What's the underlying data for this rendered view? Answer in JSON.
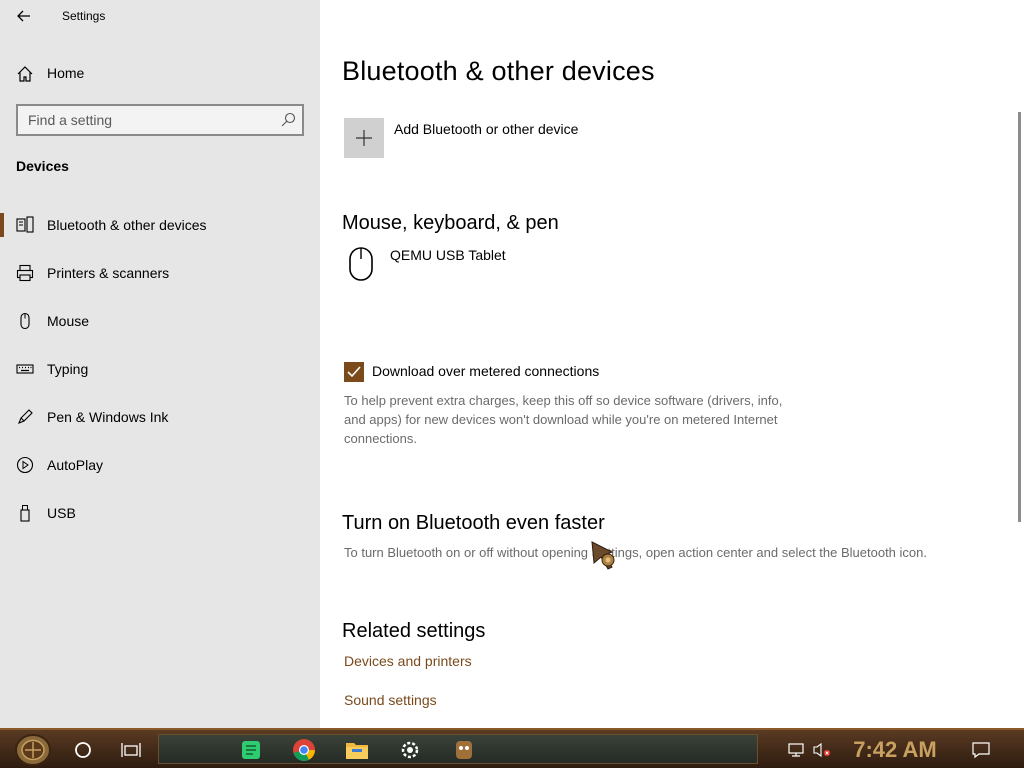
{
  "window": {
    "title": "Settings",
    "back_icon": "arrow-left-icon",
    "minimize_icon": "minimize-icon",
    "restore_icon": "restore-icon",
    "close_icon": "close-icon"
  },
  "sidebar": {
    "home_label": "Home",
    "search_placeholder": "Find a setting",
    "section_title": "Devices",
    "items": [
      {
        "label": "Bluetooth & other devices",
        "icon": "bluetooth-devices-icon",
        "selected": true
      },
      {
        "label": "Printers & scanners",
        "icon": "printer-icon",
        "selected": false
      },
      {
        "label": "Mouse",
        "icon": "mouse-icon",
        "selected": false
      },
      {
        "label": "Typing",
        "icon": "keyboard-icon",
        "selected": false
      },
      {
        "label": "Pen & Windows Ink",
        "icon": "pen-icon",
        "selected": false
      },
      {
        "label": "AutoPlay",
        "icon": "autoplay-icon",
        "selected": false
      },
      {
        "label": "USB",
        "icon": "usb-icon",
        "selected": false
      }
    ]
  },
  "main": {
    "title": "Bluetooth & other devices",
    "add_device_label": "Add Bluetooth or other device",
    "mouse_section_title": "Mouse, keyboard, & pen",
    "device_name": "QEMU USB Tablet",
    "metered_checkbox_label": "Download over metered connections",
    "metered_checked": true,
    "metered_help": "To help prevent extra charges, keep this off so device software (drivers, info, and apps) for new devices won't download while you're on metered Internet connections.",
    "faster_title": "Turn on Bluetooth even faster",
    "faster_text": "To turn Bluetooth on or off without opening Settings, open action center and select the Bluetooth icon.",
    "related_title": "Related settings",
    "related_links": [
      "Devices and printers",
      "Sound settings"
    ]
  },
  "taskbar": {
    "clock": "7:42 AM",
    "icons": [
      "start-icon",
      "cortana-icon",
      "task-view-icon",
      "notes-app-icon",
      "chrome-icon",
      "file-explorer-icon",
      "settings-icon",
      "pinned-app-icon",
      "network-icon",
      "volume-muted-icon",
      "action-center-icon"
    ]
  },
  "colors": {
    "accent": "#7a4a1a",
    "sidebar_bg": "#e6e6e6",
    "secondary_text": "#6b6b6b"
  }
}
